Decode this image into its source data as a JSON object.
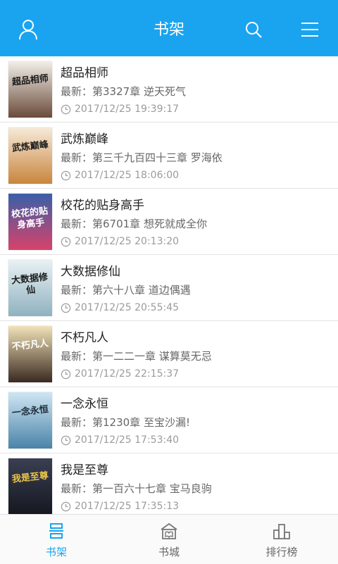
{
  "header": {
    "title": "书架",
    "user_icon": "user-icon",
    "search_icon": "search-icon",
    "menu_icon": "menu-icon",
    "bg_color": "#1aa4ef"
  },
  "books": [
    {
      "title": "超品相师",
      "latest": "最新：第3327章 逆天死气",
      "time": "2017/12/25 19:39:17",
      "cover": {
        "text": "超品相师",
        "top": "#f2efe8",
        "bottom": "#6b4b3a",
        "ink": "#1a1a1a"
      }
    },
    {
      "title": "武炼巅峰",
      "latest": "最新：第三千九百四十三章 罗海依",
      "time": "2017/12/25 18:06:00",
      "cover": {
        "text": "武炼巅峰",
        "top": "#f6ead8",
        "bottom": "#c9853e",
        "ink": "#222222"
      }
    },
    {
      "title": "校花的贴身高手",
      "latest": "最新：第6701章 想死就成全你",
      "time": "2017/12/25 20:13:20",
      "cover": {
        "text": "校花的贴身高手",
        "top": "#3a5fa8",
        "bottom": "#d8426a",
        "ink": "#ffffff"
      }
    },
    {
      "title": "大数据修仙",
      "latest": "最新：第六十八章 道边偶遇",
      "time": "2017/12/25 20:55:45",
      "cover": {
        "text": "大数据修仙",
        "top": "#e9f1f3",
        "bottom": "#8fb1c0",
        "ink": "#1b1b1b"
      }
    },
    {
      "title": "不朽凡人",
      "latest": "最新：第一二二一章 谋算莫无忌",
      "time": "2017/12/25 22:15:37",
      "cover": {
        "text": "不朽凡人",
        "top": "#f1e2b8",
        "bottom": "#3a2a20",
        "ink": "#ffffff"
      }
    },
    {
      "title": "一念永恒",
      "latest": "最新：第1230章 至宝沙漏!",
      "time": "2017/12/25 17:53:40",
      "cover": {
        "text": "一念永恒",
        "top": "#cfe6f3",
        "bottom": "#4a83a8",
        "ink": "#1d2b3a"
      }
    },
    {
      "title": "我是至尊",
      "latest": "最新：第一百六十七章 宝马良驹",
      "time": "2017/12/25 17:35:13",
      "cover": {
        "text": "我是至尊",
        "top": "#3a3f52",
        "bottom": "#151820",
        "ink": "#e9c447"
      }
    }
  ],
  "tabs": [
    {
      "label": "书架",
      "icon": "bookshelf-icon",
      "active": true
    },
    {
      "label": "书城",
      "icon": "bookstore-icon",
      "active": false
    },
    {
      "label": "排行榜",
      "icon": "ranking-icon",
      "active": false
    }
  ],
  "colors": {
    "accent": "#1aa4ef",
    "inactive": "#666666"
  }
}
